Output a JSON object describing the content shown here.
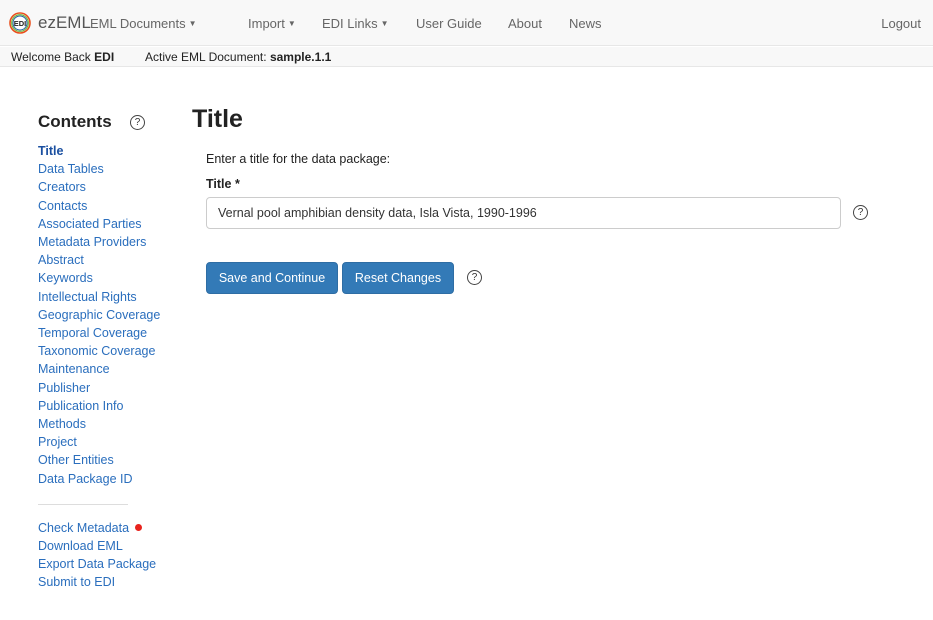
{
  "navbar": {
    "brand": "ezEML",
    "logo_text": "EDI",
    "items": [
      {
        "label": "EML Documents",
        "dropdown": true
      },
      {
        "label": "Import",
        "dropdown": true
      },
      {
        "label": "EDI Links",
        "dropdown": true
      },
      {
        "label": "User Guide",
        "dropdown": false
      },
      {
        "label": "About",
        "dropdown": false
      },
      {
        "label": "News",
        "dropdown": false
      }
    ],
    "logout": "Logout"
  },
  "subbar": {
    "welcome_prefix": "Welcome Back",
    "user": "EDI",
    "active_prefix": "Active EML Document:",
    "active_document": "sample.1.1"
  },
  "sidebar": {
    "title": "Contents",
    "help": "?",
    "items": [
      {
        "label": "Title",
        "active": true
      },
      {
        "label": "Data Tables"
      },
      {
        "label": "Creators"
      },
      {
        "label": "Contacts"
      },
      {
        "label": "Associated Parties"
      },
      {
        "label": "Metadata Providers"
      },
      {
        "label": "Abstract"
      },
      {
        "label": "Keywords"
      },
      {
        "label": "Intellectual Rights"
      },
      {
        "label": "Geographic Coverage"
      },
      {
        "label": "Temporal Coverage"
      },
      {
        "label": "Taxonomic Coverage"
      },
      {
        "label": "Maintenance"
      },
      {
        "label": "Publisher"
      },
      {
        "label": "Publication Info"
      },
      {
        "label": "Methods"
      },
      {
        "label": "Project"
      },
      {
        "label": "Other Entities"
      },
      {
        "label": "Data Package ID"
      }
    ],
    "actions": [
      {
        "label": "Check Metadata",
        "status_dot": true
      },
      {
        "label": "Download EML"
      },
      {
        "label": "Export Data Package"
      },
      {
        "label": "Submit to EDI"
      }
    ]
  },
  "main": {
    "heading": "Title",
    "instructions": "Enter a title for the data package:",
    "field_label": "Title *",
    "title_value": "Vernal pool amphibian density data, Isla Vista, 1990-1996",
    "help": "?",
    "save_label": "Save and Continue",
    "reset_label": "Reset Changes"
  },
  "colors": {
    "link": "#2a6ebd",
    "primary_button": "#337ab7",
    "status_dot": "#e8231d",
    "navbar_bg": "#f8f8f8"
  },
  "icons": {
    "logo": "edi-logo-icon",
    "help": "question-circle-icon",
    "dropdown": "caret-down-icon",
    "status": "red-dot-icon"
  }
}
